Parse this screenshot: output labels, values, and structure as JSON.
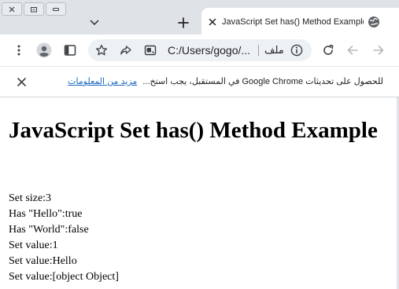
{
  "browser": {
    "tab": {
      "title": "JavaScript Set has() Method Example"
    },
    "toolbar": {
      "url": "C:/Users/gogo/...",
      "site_label": "ملف"
    },
    "infobar": {
      "message": "للحصول على تحديثات Google Chrome في المستقبل، يجب استخ...",
      "link": "مزيد من المعلومات"
    },
    "icons": {
      "tab_dropdown": "chevron-down-icon",
      "new_tab": "plus-icon",
      "tab_close": "close-icon",
      "favicon": "globe-icon",
      "menu": "kebab-menu-icon",
      "profile": "profile-icon",
      "side_panel": "side-panel-icon",
      "bookmark": "star-icon",
      "share": "share-icon",
      "install": "install-app-icon",
      "site_info": "info-icon",
      "reload": "reload-icon",
      "back": "back-arrow-icon",
      "forward": "forward-arrow-icon"
    }
  },
  "page": {
    "heading": "JavaScript Set has() Method Example",
    "lines": [
      "Set size:3",
      "Has \"Hello\":true",
      "Has \"World\":false",
      "Set value:1",
      "Set value:Hello",
      "Set value:[object Object]"
    ]
  }
}
